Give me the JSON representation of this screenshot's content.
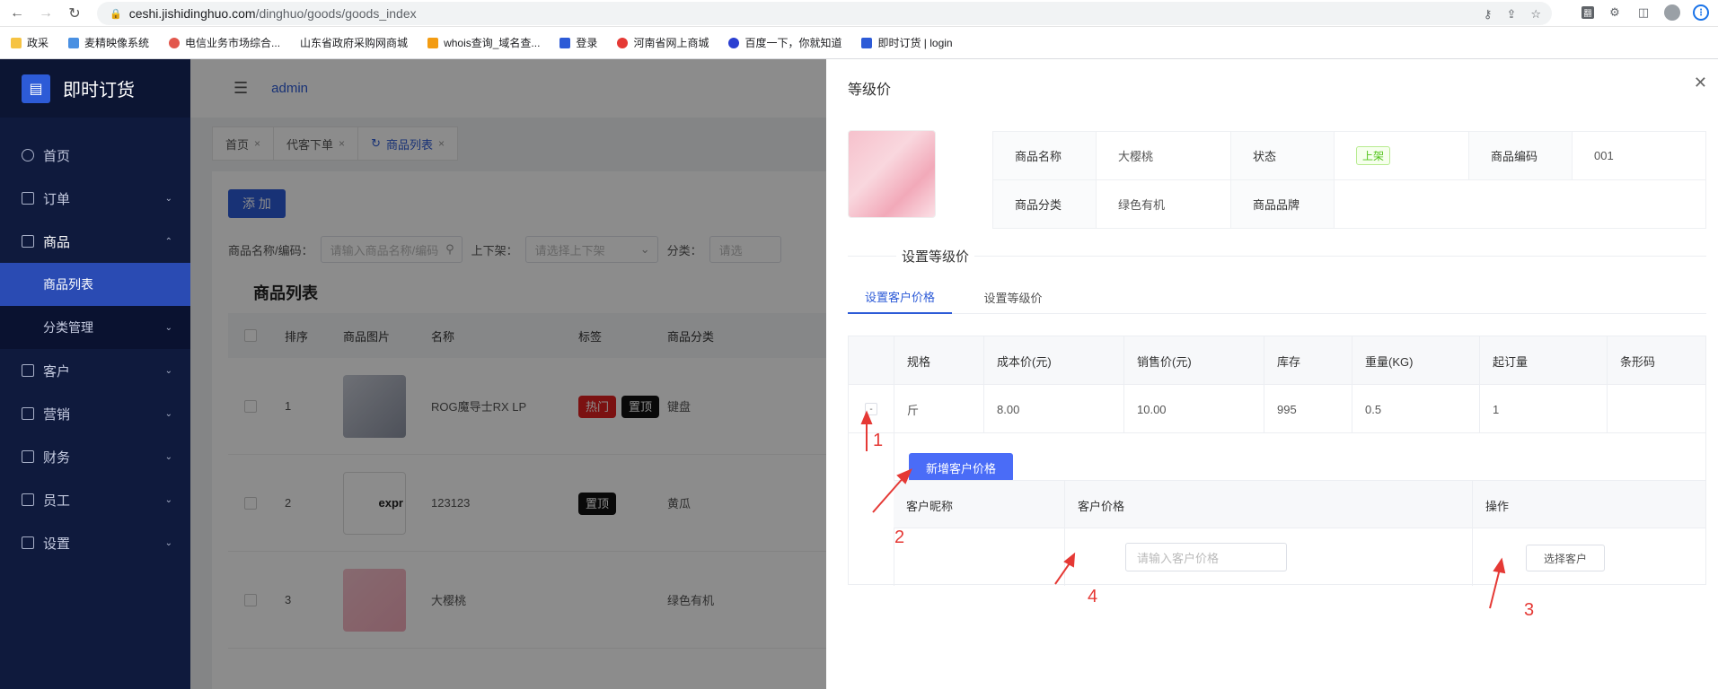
{
  "browser": {
    "url_host": "ceshi.jishidinghuo.com",
    "url_path": "/dinghuo/goods/goods_index",
    "bookmarks": [
      "政采",
      "麦精映像系统",
      "电信业务市场综合...",
      "山东省政府采购网商城",
      "whois查询_域名查...",
      "登录",
      "河南省网上商城",
      "百度一下，你就知道",
      "即时订货 | login"
    ]
  },
  "app": {
    "logo": "即时订货",
    "user": "admin",
    "menu": [
      {
        "label": "首页"
      },
      {
        "label": "订单"
      },
      {
        "label": "商品"
      },
      {
        "label": "客户"
      },
      {
        "label": "营销"
      },
      {
        "label": "财务"
      },
      {
        "label": "员工"
      },
      {
        "label": "设置"
      }
    ],
    "submenu": [
      "商品列表",
      "分类管理"
    ],
    "tabs": [
      "首页",
      "代客下单",
      "商品列表"
    ],
    "add_btn": "添 加",
    "filter": {
      "name_label": "商品名称/编码：",
      "name_placeholder": "请输入商品名称/编码",
      "shelf_label": "上下架：",
      "shelf_placeholder": "请选择上下架",
      "cat_label": "分类：",
      "cat_placeholder": "请选"
    },
    "list_title": "商品列表",
    "columns": [
      "排序",
      "商品图片",
      "名称",
      "标签",
      "商品分类"
    ],
    "rows": [
      {
        "sort": "1",
        "name": "ROG魔导士RX LP",
        "tags": [
          "热门",
          "置顶"
        ],
        "cat": "键盘"
      },
      {
        "sort": "2",
        "name": "123123",
        "tags": [
          "置顶"
        ],
        "cat": "黄瓜",
        "img_text": "expr"
      },
      {
        "sort": "3",
        "name": "大樱桃",
        "tags": [],
        "cat": "绿色有机"
      }
    ]
  },
  "drawer": {
    "title": "等级价",
    "info": {
      "name_label": "商品名称",
      "name": "大樱桃",
      "status_label": "状态",
      "status": "上架",
      "code_label": "商品编码",
      "code": "001",
      "cat_label": "商品分类",
      "cat": "绿色有机",
      "brand_label": "商品品牌",
      "brand": ""
    },
    "section_title": "设置等级价",
    "sub_tabs": [
      "设置客户价格",
      "设置等级价"
    ],
    "spec_columns": [
      "规格",
      "成本价(元)",
      "销售价(元)",
      "库存",
      "重量(KG)",
      "起订量",
      "条形码"
    ],
    "spec_row": {
      "expand": "-",
      "spec": "斤",
      "cost": "8.00",
      "price": "10.00",
      "stock": "995",
      "weight": "0.5",
      "moq": "1",
      "barcode": ""
    },
    "add_customer_price": "新增客户价格",
    "cust_columns": [
      "客户昵称",
      "客户价格",
      "操作"
    ],
    "price_placeholder": "请输入客户价格",
    "select_customer": "选择客户",
    "annotations": [
      "1",
      "2",
      "3",
      "4"
    ]
  },
  "colors": {
    "primary": "#2d5bd7",
    "sidebar": "#0f1a3d",
    "annotation": "#e53935"
  }
}
